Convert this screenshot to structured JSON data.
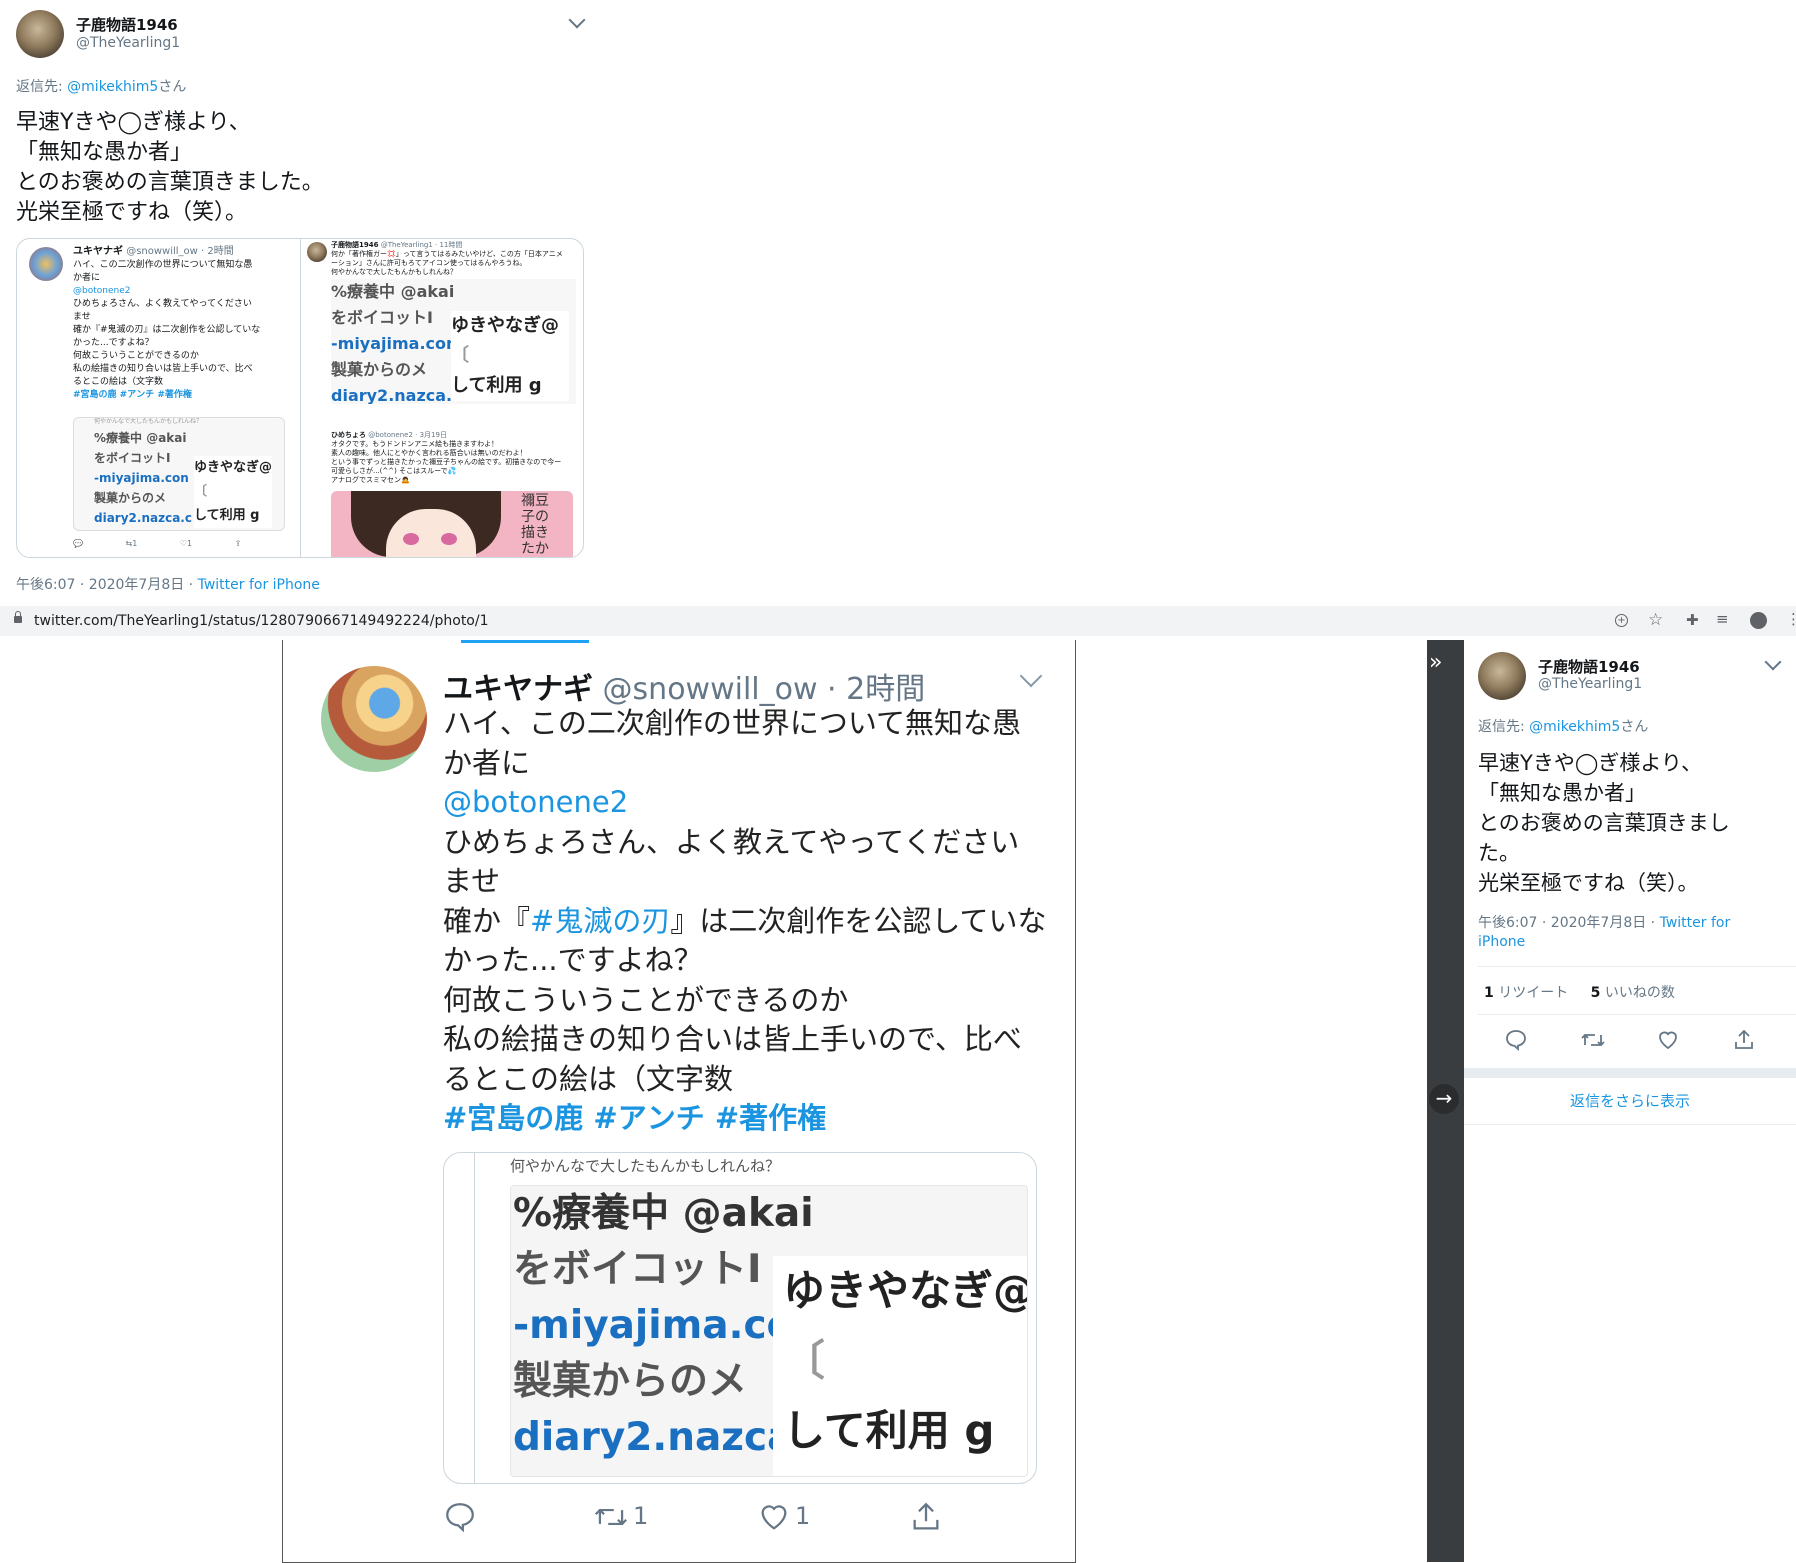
{
  "top_tweet": {
    "name": "子鹿物語1946",
    "handle": "@TheYearling1",
    "reply_prefix": "返信先: ",
    "reply_to": "@mikekhim5",
    "reply_suffix": "さん",
    "lines": [
      "早速Yきや◯ぎ様より、",
      "「無知な愚か者」",
      "とのお褒めの言葉頂きました。",
      "光栄至極ですね（笑）。"
    ],
    "time": "午後6:07 · 2020年7月8日 · ",
    "source": "Twitter for iPhone"
  },
  "thumb": {
    "left": {
      "name": "ユキヤナギ",
      "meta": "@snowwill_ow · 2時間",
      "lines": [
        "ハイ、この二次創作の世界について無知な愚",
        "か者に"
      ],
      "mention": "@botonene2",
      "lines2": [
        " ひめちょろさん、よく教えてやってください",
        "ませ",
        "確か『#鬼滅の刃』は二次創作を公認していな",
        "かった...ですよね？",
        "何故こういうことができるのか",
        "私の絵描きの知り合いは皆上手いので、比べ",
        "るとこの絵は（文字数"
      ],
      "hashtags": "#宮島の鹿 #アンチ #著作権",
      "quote_top": "何やかんなで大したもんかもしれんね？",
      "crop_left": [
        "%療養中 @akai",
        "をボイコットI",
        "-miyajima.con",
        "製菓からのメ",
        "diary2.nazca.c"
      ],
      "crop_right": [
        "ゆきやなぎ@",
        "〔",
        "して利用 g"
      ],
      "rt": "1",
      "like": "1"
    },
    "right": {
      "name": "子鹿物語1946",
      "meta": "@TheYearling1 · 11時間",
      "lines": [
        "何か「著作権ガー💢」って言うてはるみたいやけど、この方「日本アニメ",
        "ーション」さんに許可もろてアイコン使ってはるんやろうね。",
        "何やかんなで大したもんかもしれんね？"
      ],
      "crop_left": [
        "%療養中 @akai",
        "をボイコットI",
        "-miyajima.con",
        "製菓からのメ",
        "diary2.nazca.c"
      ],
      "crop_right": [
        "ゆきやなぎ@",
        "〔",
        "して利用 g"
      ],
      "reply_name": "ひめちょろ",
      "reply_meta": "@botonene2 · 3月19日",
      "reply_lines": [
        "オタクです。もうドンドンアニメ絵も描きますわよ！",
        "素人の趣味。他人にとやかく言われる筋合いは無いのだわよ！",
        "という事でずっと描きたかった禰豆子ちゃんの絵です。初描きなので今ー",
        "可愛らしさが...(^^) そこはスルーで💦",
        "アナログでスミマセン🙇"
      ],
      "art_text": "禰豆子の 描きたかった"
    }
  },
  "browser": {
    "url": "twitter.com/TheYearling1/status/1280790667149492224/photo/1"
  },
  "photo": {
    "name": "ユキヤナギ",
    "meta": "@snowwill_ow · 2時間",
    "lines": [
      "ハイ、この二次創作の世界について無知な愚",
      "か者に"
    ],
    "mention": "@botonene2",
    "line3": " ひめちょろさん、よく教えてやってください",
    "line4": "ませ",
    "line5_pre": "確か『",
    "line5_tag": "#鬼滅の刃",
    "line5_post": "』は二次創作を公認していな",
    "lines_rest": [
      "かった...ですよね？",
      "何故こういうことができるのか",
      "私の絵描きの知り合いは皆上手いので、比べ",
      "るとこの絵は（文字数"
    ],
    "hashtags": [
      "#宮島の鹿",
      "#アンチ",
      "#著作権"
    ],
    "quote_top": "何やかんなで大したもんかもしれんね？",
    "crop_left": [
      "%療養中 @akai",
      "をボイコットI",
      "-miyajima.con",
      "製菓からのメ",
      "diary2.nazca.c"
    ],
    "crop_right": [
      "ゆきやなぎ@",
      "〔",
      "して利用 g"
    ],
    "rt": "1",
    "like": "1"
  },
  "side": {
    "name": "子鹿物語1946",
    "handle": "@TheYearling1",
    "reply_prefix": "返信先: ",
    "reply_to": "@mikekhim5",
    "reply_suffix": "さん",
    "lines": [
      "早速Yきや◯ぎ様より、",
      "「無知な愚か者」",
      "とのお褒めの言葉頂きまし",
      "た。",
      "光栄至極ですね（笑）。"
    ],
    "time": "午後6:07 · 2020年7月8日 · ",
    "source1": "Twitter for",
    "source2": "iPhone",
    "rt_count": "1",
    "rt_label": " リツイート",
    "like_count": "5",
    "like_label": " いいねの数",
    "more_replies": "返信をさらに表示"
  }
}
